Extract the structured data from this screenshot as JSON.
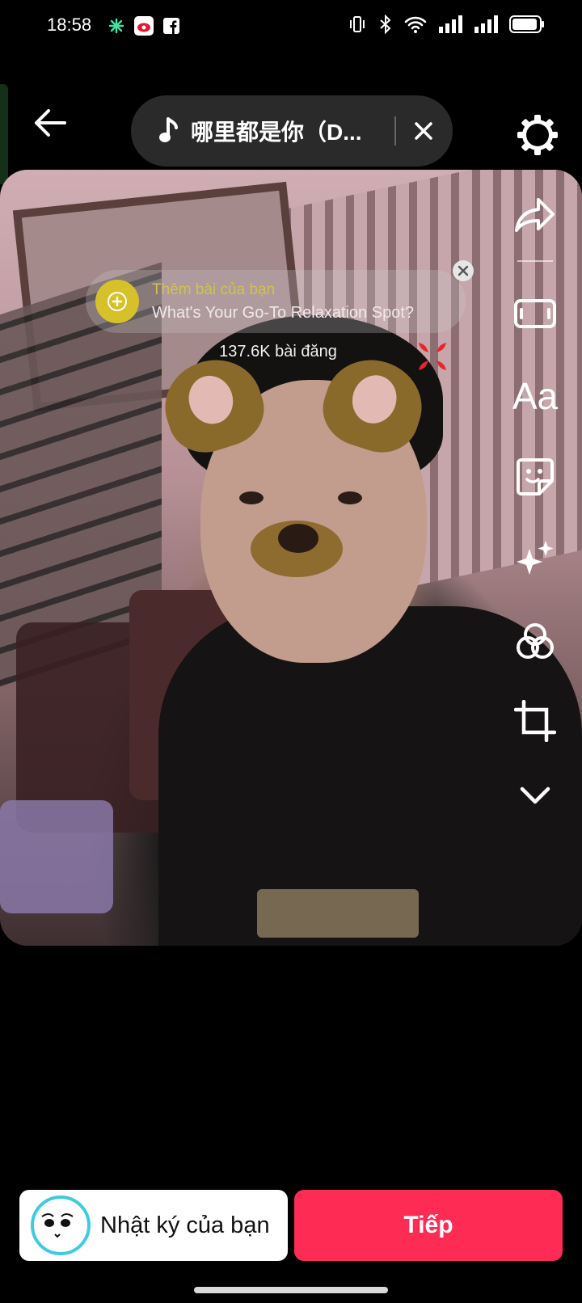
{
  "status_bar": {
    "time": "18:58",
    "left_icons": [
      "sparkle-app-icon",
      "weibo-icon",
      "facebook-icon"
    ],
    "right_icons": [
      "vibrate-icon",
      "bluetooth-icon",
      "wifi-icon",
      "signal-icon",
      "signal-icon",
      "battery-icon"
    ]
  },
  "top_bar": {
    "music_title": "哪里都是你（D...",
    "back_icon": "arrow-left-icon",
    "close_icon": "close-icon",
    "settings_icon": "gear-icon"
  },
  "preview": {
    "suggestion": {
      "title": "Thêm bài của bạn",
      "subtitle": "What's Your Go-To Relaxation Spot?"
    },
    "posts_count": "137.6K bài đăng"
  },
  "tools": [
    {
      "name": "share-icon"
    },
    {
      "name": "aspect-ratio-icon"
    },
    {
      "name": "text-tool",
      "label": "Aa"
    },
    {
      "name": "sticker-icon"
    },
    {
      "name": "effects-sparkle-icon"
    },
    {
      "name": "filters-icon"
    },
    {
      "name": "crop-icon"
    },
    {
      "name": "chevron-down-icon"
    }
  ],
  "bottom": {
    "diary_label": "Nhật ký của bạn",
    "next_label": "Tiếp"
  },
  "colors": {
    "accent": "#fe2c55",
    "avatar_ring": "#3ecbe0",
    "suggestion_plus": "#d6c12a"
  }
}
